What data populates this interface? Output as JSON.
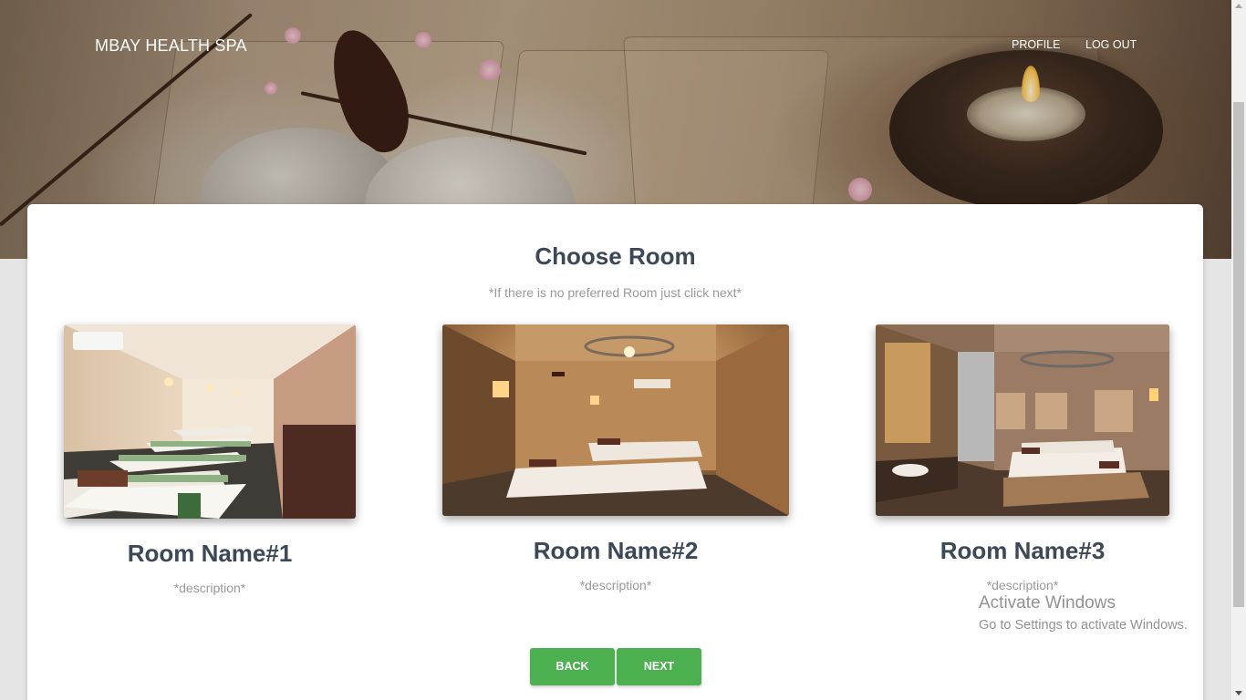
{
  "navbar": {
    "brand": "MBAY HEALTH SPA",
    "links": [
      {
        "label": "PROFILE"
      },
      {
        "label": "LOG OUT"
      }
    ]
  },
  "main": {
    "title": "Choose Room",
    "subtitle": "*If there is no preferred Room just click next*",
    "rooms": [
      {
        "name": "Room Name#1",
        "description": "*description*"
      },
      {
        "name": "Room Name#2",
        "description": "*description*"
      },
      {
        "name": "Room Name#3",
        "description": "*description*"
      }
    ],
    "buttons": {
      "back": "BACK",
      "next": "NEXT"
    }
  },
  "watermark": {
    "title": "Activate Windows",
    "subtitle": "Go to Settings to activate Windows."
  },
  "colors": {
    "accent": "#4caf50",
    "heading": "#3c4858",
    "muted": "#999999"
  }
}
